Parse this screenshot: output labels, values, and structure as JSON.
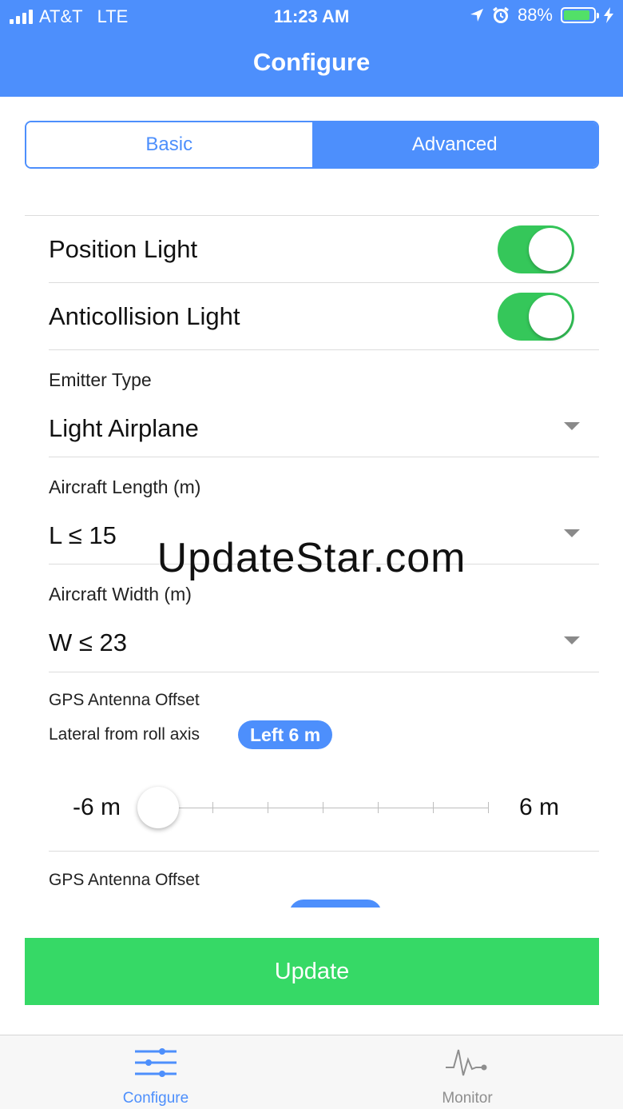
{
  "status_bar": {
    "carrier": "AT&T",
    "network": "LTE",
    "time": "11:23 AM",
    "battery": "88%",
    "battery_level": 0.88
  },
  "header": {
    "title": "Configure"
  },
  "segments": {
    "basic": "Basic",
    "advanced": "Advanced",
    "selected": "Advanced"
  },
  "settings": {
    "position_light": {
      "label": "Position Light",
      "on": true
    },
    "anticollision_light": {
      "label": "Anticollision Light",
      "on": true
    },
    "emitter_type": {
      "label": "Emitter Type",
      "value": "Light Airplane"
    },
    "aircraft_length": {
      "label": "Aircraft Length (m)",
      "value": "L ≤ 15"
    },
    "aircraft_width": {
      "label": "Aircraft Width (m)",
      "value": "W ≤ 23"
    },
    "gps_lateral": {
      "label": "GPS Antenna Offset",
      "sublabel": "Lateral from roll axis",
      "value": "Left 6 m",
      "slider_min": "-6 m",
      "slider_max": "6 m",
      "slider_position": 0
    },
    "gps_longitudinal": {
      "label": "GPS Antenna Offset"
    }
  },
  "watermark": "UpdateStar.com",
  "update_button": "Update",
  "tabs": {
    "configure": "Configure",
    "monitor": "Monitor",
    "active": "configure"
  },
  "colors": {
    "accent": "#4d8ffc",
    "toggle_on": "#35c75a",
    "update": "#36d966"
  }
}
